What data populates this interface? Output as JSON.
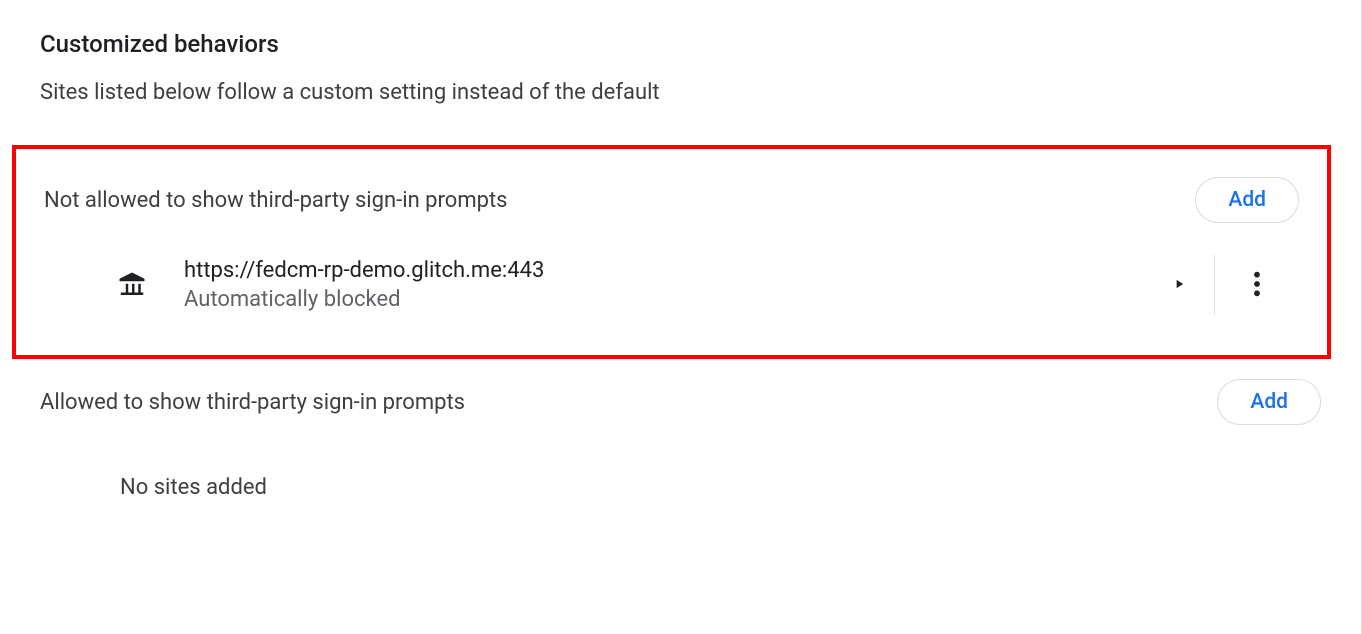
{
  "header": {
    "title": "Customized behaviors",
    "description": "Sites listed below follow a custom setting instead of the default"
  },
  "not_allowed": {
    "title": "Not allowed to show third-party sign-in prompts",
    "add_label": "Add",
    "sites": [
      {
        "url": "https://fedcm-rp-demo.glitch.me:443",
        "status": "Automatically blocked"
      }
    ]
  },
  "allowed": {
    "title": "Allowed to show third-party sign-in prompts",
    "add_label": "Add",
    "empty_text": "No sites added"
  }
}
